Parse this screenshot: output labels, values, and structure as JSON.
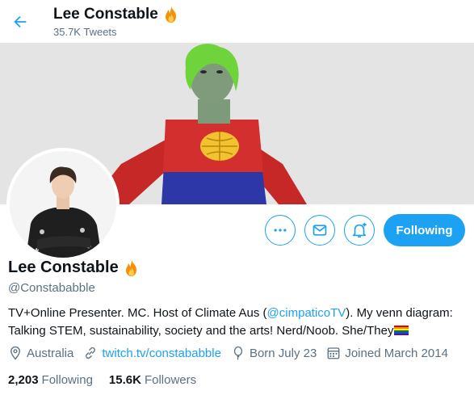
{
  "header": {
    "name": "Lee Constable",
    "tweet_count": "35.7K Tweets"
  },
  "profile": {
    "name": "Lee Constable",
    "handle": "@Constababble",
    "bio_part1": "TV+Online Presenter. MC. Host of Climate Aus (",
    "bio_link": "@cimpaticoTV",
    "bio_part2": "). My venn diagram: Talking STEM, sustainability, society and the arts! Nerd/Noob. She/They",
    "location": "Australia",
    "website": "twitch.tv/constababble",
    "birthday": "Born July 23",
    "joined": "Joined March 2014"
  },
  "actions": {
    "follow_label": "Following"
  },
  "stats": {
    "following_count": "2,203",
    "following_label": "Following",
    "followers_count": "15.6K",
    "followers_label": "Followers"
  },
  "colors": {
    "accent": "#1da1f2",
    "secondary_text": "#5b7083"
  },
  "icons": [
    "back-arrow-icon",
    "fire-emoji-icon",
    "more-icon",
    "mail-icon",
    "bell-plus-icon",
    "location-icon",
    "link-icon",
    "balloon-icon",
    "calendar-icon",
    "rainbow-flag-icon"
  ]
}
